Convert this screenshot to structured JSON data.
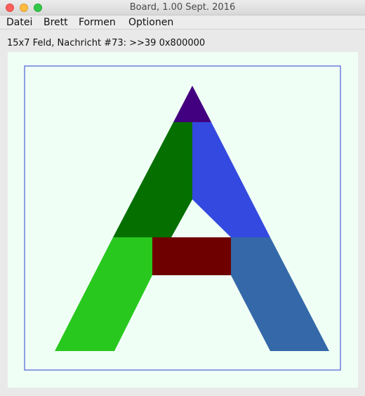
{
  "window": {
    "title": "Board, 1.00 Sept. 2016"
  },
  "menu": {
    "items": [
      {
        "label": "Datei"
      },
      {
        "label": "Brett"
      },
      {
        "label": "Formen"
      },
      {
        "label": "Optionen"
      }
    ]
  },
  "status": {
    "text": "15x7 Feld, Nachricht #73: >>39 0x800000"
  },
  "board": {
    "background_color": "#f0fff6",
    "frame_color": "#4a5fd6",
    "shapes": [
      {
        "name": "apex-triangle",
        "color": "#420080"
      },
      {
        "name": "upper-left-parallelogram",
        "color": "#056f00"
      },
      {
        "name": "upper-right-parallelogram",
        "color": "#3449e0"
      },
      {
        "name": "lower-left-parallelogram",
        "color": "#28c81e"
      },
      {
        "name": "crossbar-rectangle",
        "color": "#6e0000"
      },
      {
        "name": "lower-right-parallelogram",
        "color": "#3468a8"
      }
    ]
  }
}
